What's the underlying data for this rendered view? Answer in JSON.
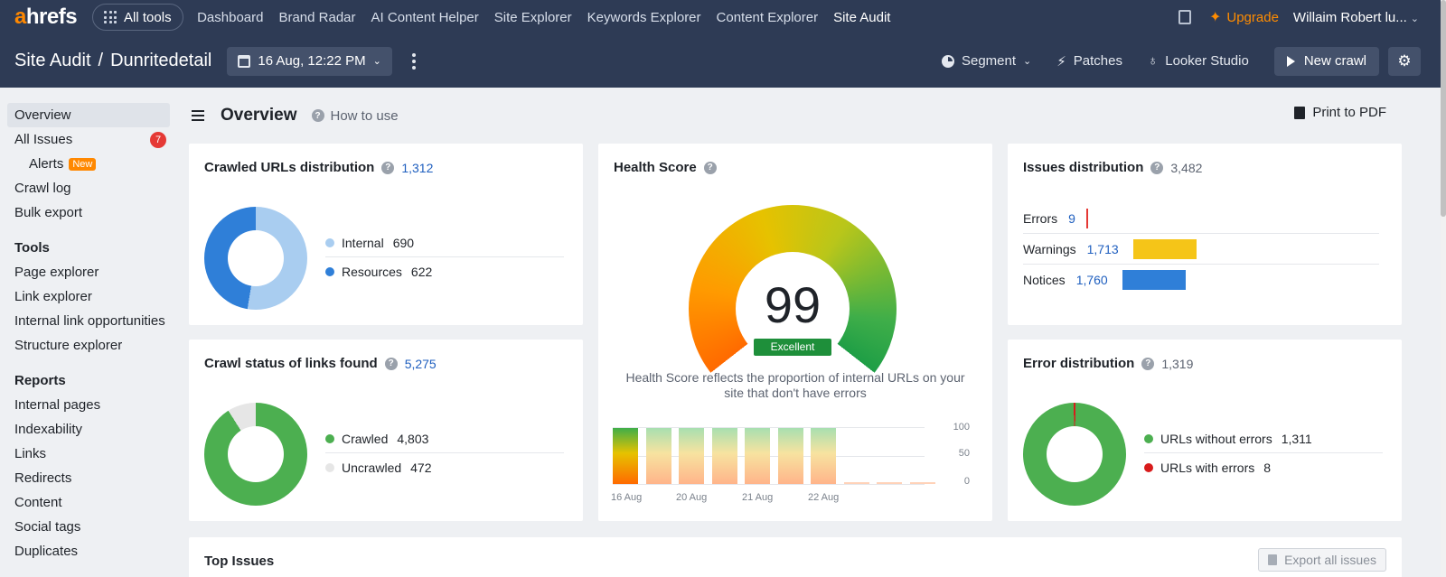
{
  "topnav": {
    "logo_a": "a",
    "logo_rest": "hrefs",
    "all_tools": "All tools",
    "links": [
      "Dashboard",
      "Brand Radar",
      "AI Content Helper",
      "Site Explorer",
      "Keywords Explorer",
      "Content Explorer",
      "Site Audit"
    ],
    "active_link": "Site Audit",
    "upgrade": "Upgrade",
    "user": "Willaim Robert lu..."
  },
  "subbar": {
    "tool": "Site Audit",
    "separator": "/",
    "project": "Dunritedetail",
    "date": "16 Aug, 12:22 PM",
    "segment": "Segment",
    "patches": "Patches",
    "looker": "Looker Studio",
    "new_crawl": "New crawl"
  },
  "sidebar": {
    "overview": "Overview",
    "all_issues": "All Issues",
    "all_issues_badge": "7",
    "alerts": "Alerts",
    "alerts_badge": "New",
    "crawl_log": "Crawl log",
    "bulk_export": "Bulk export",
    "tools_heading": "Tools",
    "tools": [
      "Page explorer",
      "Link explorer",
      "Internal link opportunities",
      "Structure explorer"
    ],
    "reports_heading": "Reports",
    "reports": [
      "Internal pages",
      "Indexability",
      "Links",
      "Redirects",
      "Content",
      "Social tags",
      "Duplicates"
    ]
  },
  "main": {
    "title": "Overview",
    "how_to_use": "How to use",
    "print_pdf": "Print to PDF"
  },
  "crawled_urls": {
    "title": "Crawled URLs distribution",
    "count": "1,312",
    "items": [
      {
        "label": "Internal",
        "value": "690",
        "color": "#a9cdf0"
      },
      {
        "label": "Resources",
        "value": "622",
        "color": "#2f7fd8"
      }
    ]
  },
  "crawl_status": {
    "title": "Crawl status of links found",
    "count": "5,275",
    "items": [
      {
        "label": "Crawled",
        "value": "4,803",
        "color": "#4caf50"
      },
      {
        "label": "Uncrawled",
        "value": "472",
        "color": "#e6e6e6"
      }
    ]
  },
  "health": {
    "title": "Health Score",
    "score": "99",
    "rating": "Excellent",
    "description": "Health Score reflects the proportion of internal URLs on your site that don't have errors",
    "y_ticks": [
      "100",
      "50",
      "0"
    ],
    "x_ticks": [
      "16 Aug",
      "20 Aug",
      "21 Aug",
      "22 Aug"
    ],
    "bars": [
      99,
      99,
      99,
      99,
      99,
      99,
      99,
      0,
      0,
      0
    ]
  },
  "issues_distribution": {
    "title": "Issues distribution",
    "count": "3,482",
    "rows": [
      {
        "label": "Errors",
        "value": "9",
        "color": "#e53935",
        "fraction": 0.005
      },
      {
        "label": "Warnings",
        "value": "1,713",
        "color": "#f5c518",
        "fraction": 0.97
      },
      {
        "label": "Notices",
        "value": "1,760",
        "color": "#2f7fd8",
        "fraction": 1.0
      }
    ]
  },
  "error_distribution": {
    "title": "Error distribution",
    "count": "1,319",
    "items": [
      {
        "label": "URLs without errors",
        "value": "1,311",
        "color": "#4caf50"
      },
      {
        "label": "URLs with errors",
        "value": "8",
        "color": "#d81b1b"
      }
    ]
  },
  "top_issues": {
    "title": "Top Issues",
    "export": "Export all issues"
  }
}
